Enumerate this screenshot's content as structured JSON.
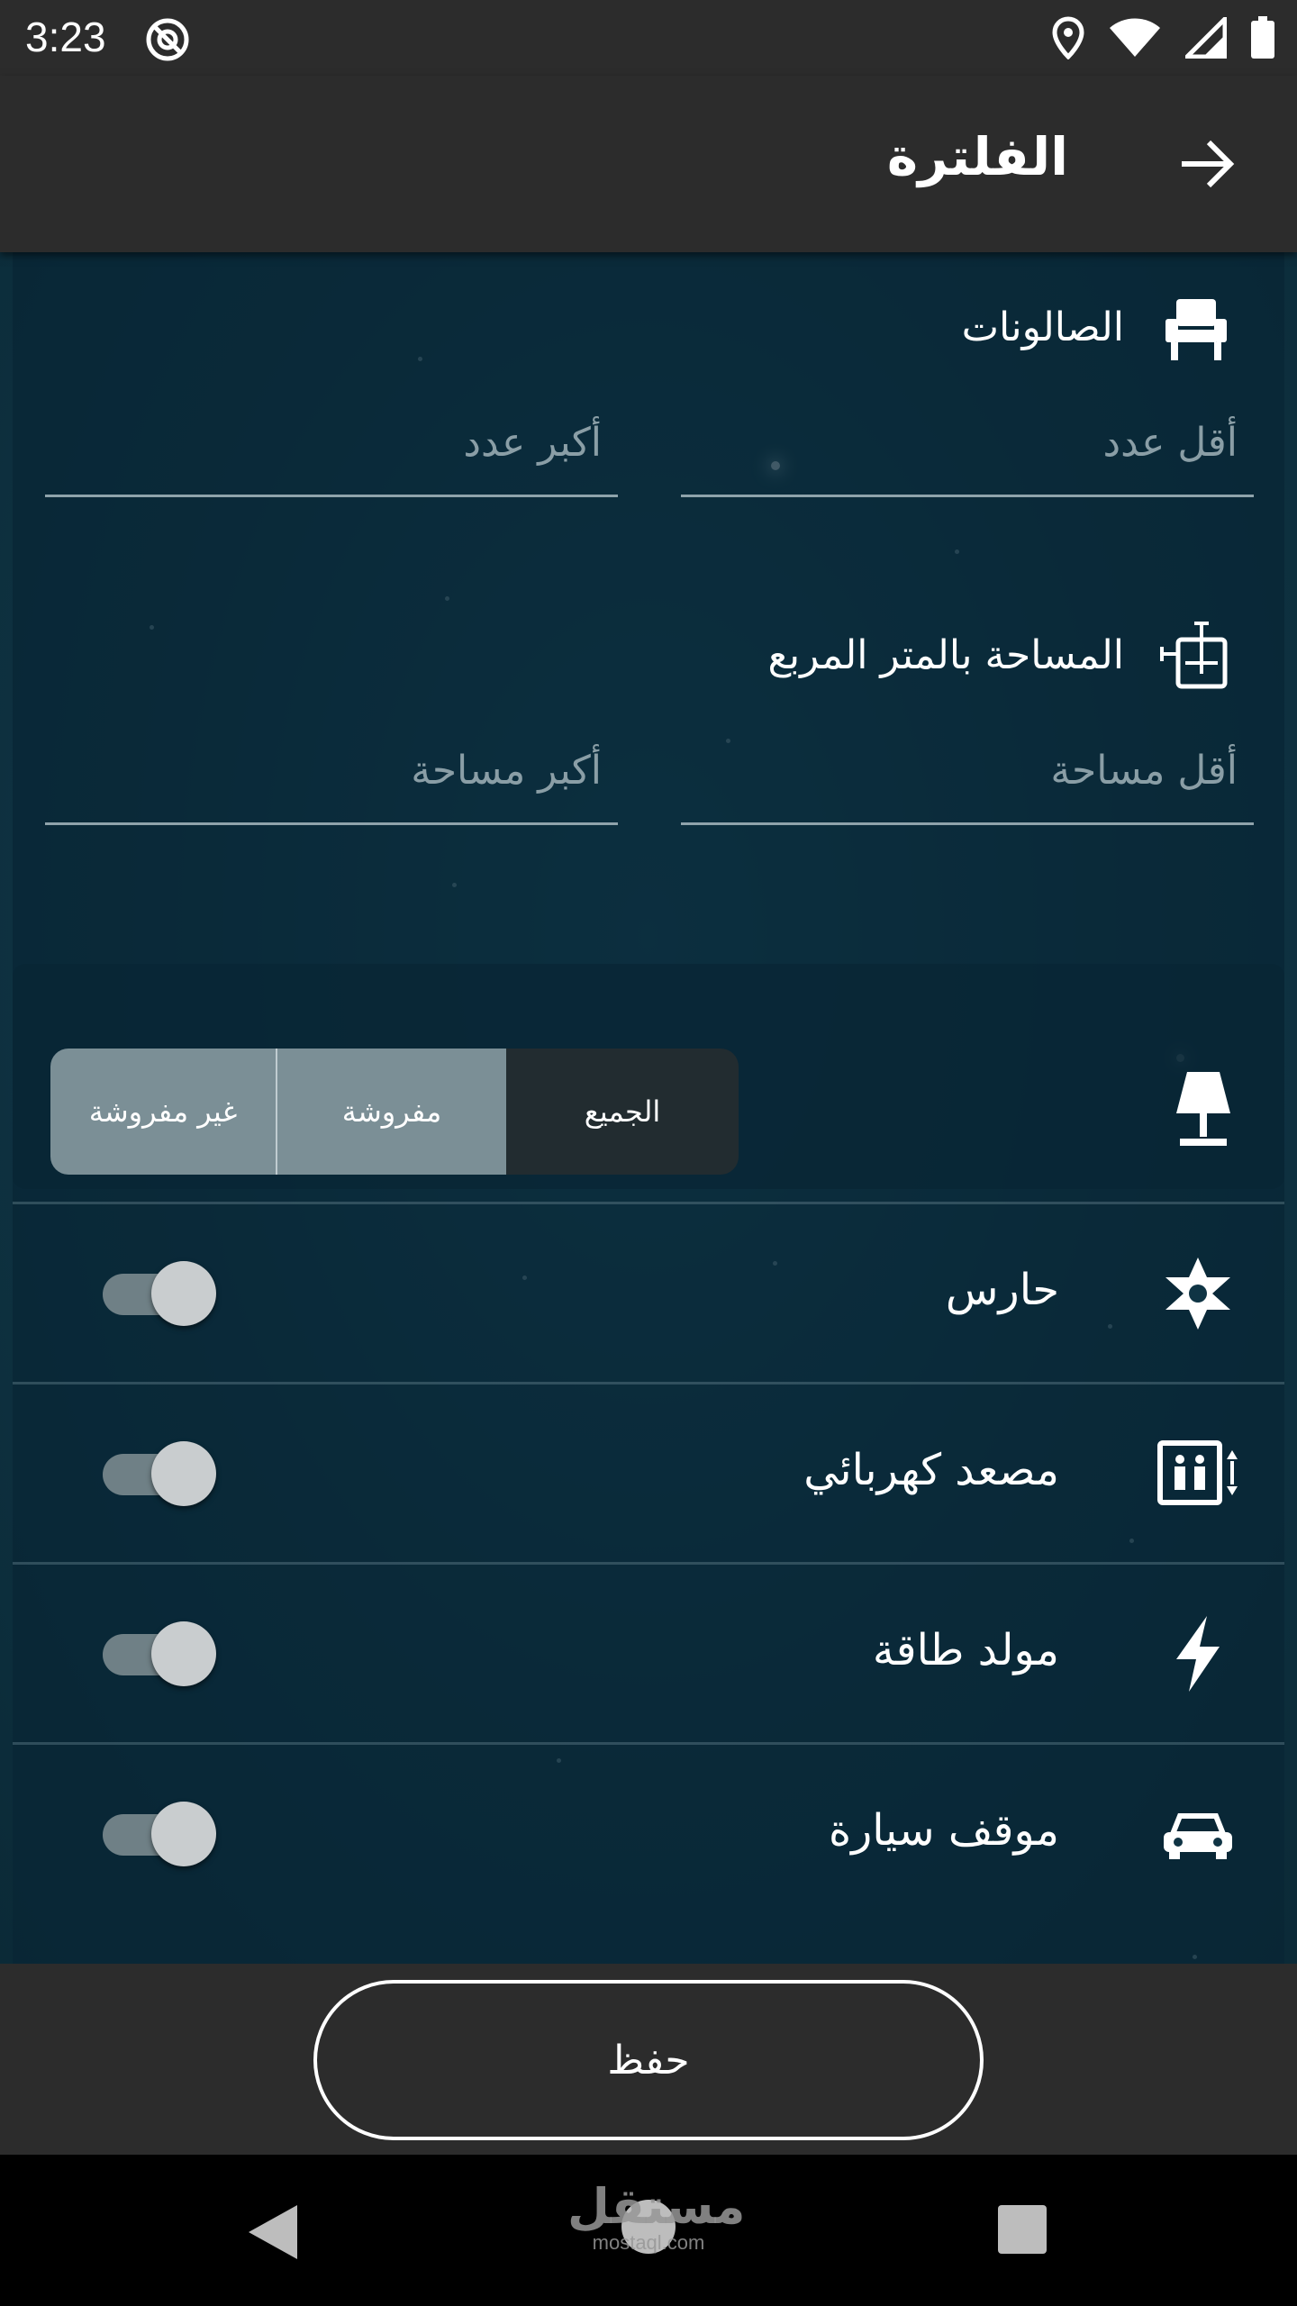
{
  "status_bar": {
    "time": "3:23"
  },
  "app_bar": {
    "title": "الفلترة"
  },
  "salons": {
    "label": "الصالونات",
    "min_placeholder": "أقل عدد",
    "max_placeholder": "أكبر عدد"
  },
  "area": {
    "label": "المساحة بالمتر المربع",
    "min_placeholder": "أقل مساحة",
    "max_placeholder": "أكبر مساحة"
  },
  "furnishing": {
    "options": [
      "الجميع",
      "مفروشة",
      "غير مفروشة"
    ],
    "selected": "الجميع"
  },
  "amenities": [
    {
      "label": "حارس",
      "icon": "sheriff-star-icon",
      "enabled": true
    },
    {
      "label": "مصعد كهربائي",
      "icon": "elevator-icon",
      "enabled": true
    },
    {
      "label": "مولد طاقة",
      "icon": "lightning-icon",
      "enabled": true
    },
    {
      "label": "موقف سيارة",
      "icon": "car-icon",
      "enabled": true
    }
  ],
  "save_button": {
    "label": "حفظ"
  },
  "watermark": {
    "arabic": "مستقل",
    "latin": "mostaql.com"
  },
  "colors": {
    "bar": "#2c2c2c",
    "background": "#0f3444",
    "accent": "#ffffff",
    "segment_inactive": "#7b8f96",
    "segment_active": "#222c30"
  }
}
